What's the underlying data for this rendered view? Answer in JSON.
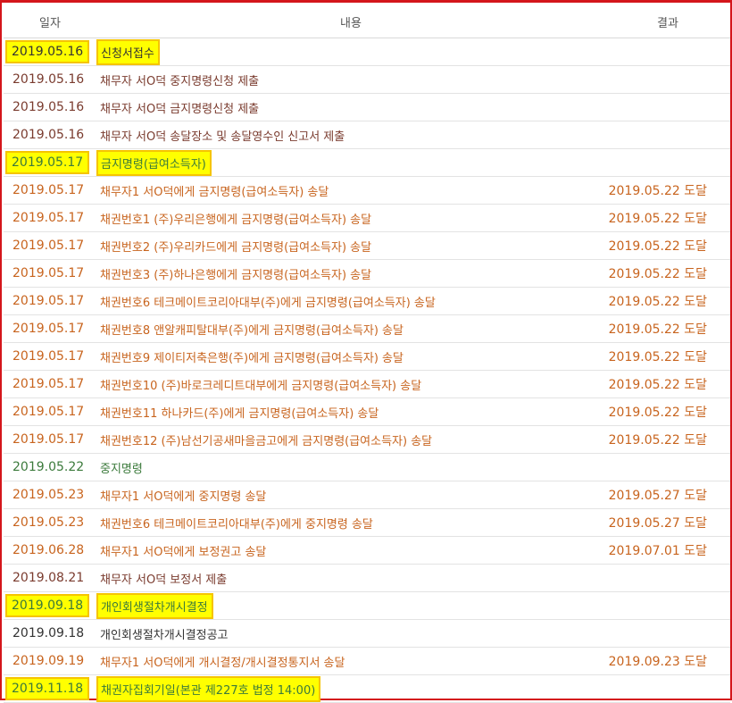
{
  "header": {
    "date": "일자",
    "content": "내용",
    "result": "결과"
  },
  "rows": [
    {
      "date": "2019.05.16",
      "content": "신청서접수",
      "result": ""
    },
    {
      "date": "2019.05.16",
      "content": "채무자 서O덕 중지명령신청 제출",
      "result": ""
    },
    {
      "date": "2019.05.16",
      "content": "채무자 서O덕 금지명령신청 제출",
      "result": ""
    },
    {
      "date": "2019.05.16",
      "content": "채무자 서O덕 송달장소 및 송달영수인 신고서 제출",
      "result": ""
    },
    {
      "date": "2019.05.17",
      "content": "금지명령(급여소득자)",
      "result": ""
    },
    {
      "date": "2019.05.17",
      "content": "채무자1 서O덕에게 금지명령(급여소득자) 송달",
      "result": "2019.05.22 도달"
    },
    {
      "date": "2019.05.17",
      "content": "채권번호1 (주)우리은행에게 금지명령(급여소득자) 송달",
      "result": "2019.05.22 도달"
    },
    {
      "date": "2019.05.17",
      "content": "채권번호2 (주)우리카드에게 금지명령(급여소득자) 송달",
      "result": "2019.05.22 도달"
    },
    {
      "date": "2019.05.17",
      "content": "채권번호3 (주)하나은행에게 금지명령(급여소득자) 송달",
      "result": "2019.05.22 도달"
    },
    {
      "date": "2019.05.17",
      "content": "채권번호6 테크메이트코리아대부(주)에게 금지명령(급여소득자) 송달",
      "result": "2019.05.22 도달"
    },
    {
      "date": "2019.05.17",
      "content": "채권번호8 앤알캐피탈대부(주)에게 금지명령(급여소득자) 송달",
      "result": "2019.05.22 도달"
    },
    {
      "date": "2019.05.17",
      "content": "채권번호9 제이티저축은행(주)에게 금지명령(급여소득자) 송달",
      "result": "2019.05.22 도달"
    },
    {
      "date": "2019.05.17",
      "content": "채권번호10 (주)바로크레디트대부에게 금지명령(급여소득자) 송달",
      "result": "2019.05.22 도달"
    },
    {
      "date": "2019.05.17",
      "content": "채권번호11 하나카드(주)에게 금지명령(급여소득자) 송달",
      "result": "2019.05.22 도달"
    },
    {
      "date": "2019.05.17",
      "content": "채권번호12 (주)남선기공새마을금고에게 금지명령(급여소득자) 송달",
      "result": "2019.05.22 도달"
    },
    {
      "date": "2019.05.22",
      "content": "중지명령",
      "result": ""
    },
    {
      "date": "2019.05.23",
      "content": "채무자1 서O덕에게 중지명령 송달",
      "result": "2019.05.27 도달"
    },
    {
      "date": "2019.05.23",
      "content": "채권번호6 테크메이트코리아대부(주)에게 중지명령 송달",
      "result": "2019.05.27 도달"
    },
    {
      "date": "2019.06.28",
      "content": "채무자1 서O덕에게 보정권고 송달",
      "result": "2019.07.01 도달"
    },
    {
      "date": "2019.08.21",
      "content": "채무자 서O덕 보정서 제출",
      "result": ""
    },
    {
      "date": "2019.09.18",
      "content": "개인회생절차개시결정",
      "result": ""
    },
    {
      "date": "2019.09.18",
      "content": "개인회생절차개시결정공고",
      "result": ""
    },
    {
      "date": "2019.09.19",
      "content": "채무자1 서O덕에게 개시결정/개시결정통지서 송달",
      "result": "2019.09.23 도달"
    },
    {
      "date": "2019.11.18",
      "content": "채권자집회기일(본관 제227호 법정 14:00)",
      "result": ""
    }
  ]
}
